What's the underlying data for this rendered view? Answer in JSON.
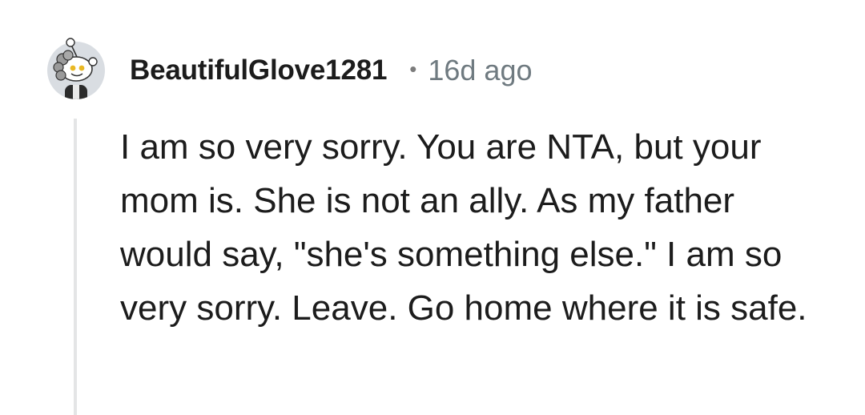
{
  "comment": {
    "username": "BeautifulGlove1281",
    "separator": "•",
    "timestamp": "16d ago",
    "body": "I am so very sorry. You are NTA, but your mom is. She is not an ally. As my father would say, \"she's something else.\" I am so very sorry. Leave. Go home where it is safe."
  },
  "icons": {
    "avatar": "snoo-avatar-icon"
  },
  "colors": {
    "username": "#1c1c1c",
    "timestamp": "#6f7a80",
    "body": "#1c1c1c",
    "thread_line": "#e4e5e6",
    "avatar_bg": "#d9dde2"
  }
}
